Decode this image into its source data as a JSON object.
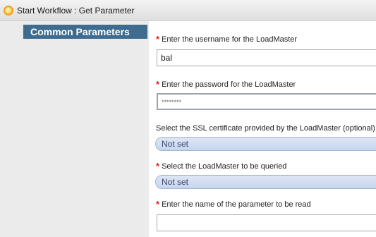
{
  "window": {
    "title": "Start Workflow : Get Parameter"
  },
  "sidebar": {
    "header": "Common Parameters"
  },
  "form": {
    "username": {
      "label": "Enter the username for the LoadMaster",
      "value": "bal"
    },
    "password": {
      "label": "Enter the password for the LoadMaster",
      "value": "********"
    },
    "ssl_certificate": {
      "label": "Select the SSL certificate provided by the LoadMaster (optional)",
      "value": "Not set"
    },
    "loadmaster": {
      "label": "Select the LoadMaster to be queried",
      "value": "Not set"
    },
    "parameter_name": {
      "label": "Enter the name of the parameter to be read",
      "value": ""
    },
    "required_marker": "*"
  }
}
